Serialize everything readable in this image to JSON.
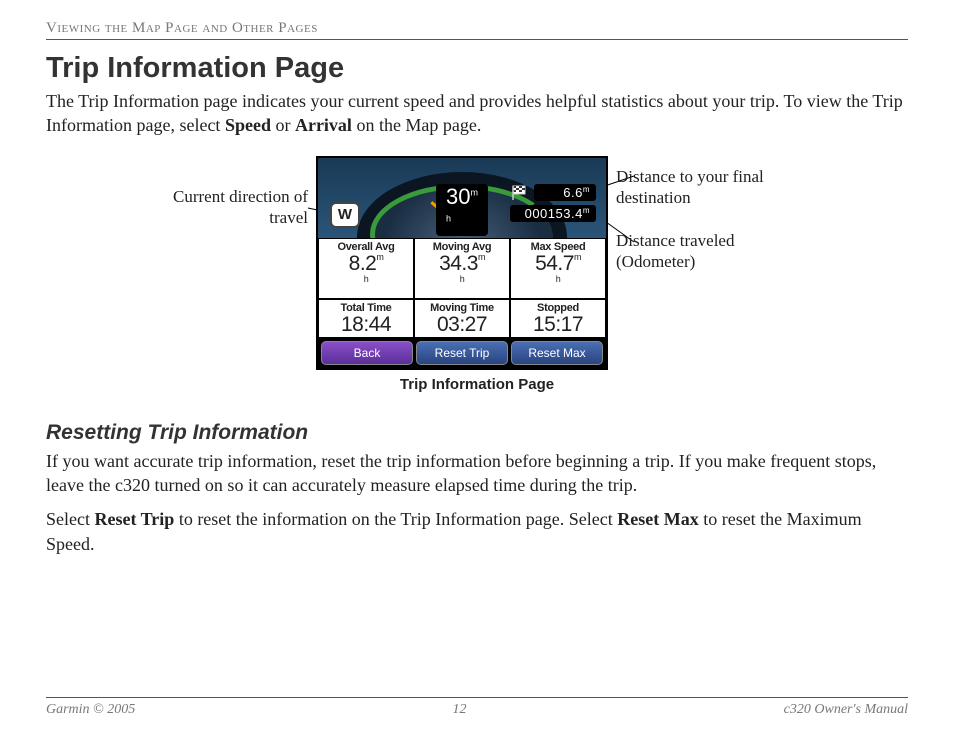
{
  "section_header": "Viewing the Map Page and Other Pages",
  "title": "Trip Information Page",
  "intro_parts": {
    "p1": "The Trip Information page indicates your current speed and provides helpful statistics about your trip. To view the Trip Information page, select ",
    "b1": "Speed",
    "p2": " or ",
    "b2": "Arrival",
    "p3": " on the Map page."
  },
  "annotations": {
    "left1": "Current direction of travel",
    "right1": "Distance to your final destination",
    "right2": "Distance traveled (Odometer)"
  },
  "device": {
    "direction": "W",
    "dist_to_dest": "6.6",
    "odometer": "000153.4",
    "speed": "30",
    "row1": {
      "c1_lbl": "Overall Avg",
      "c1_val": "8.2",
      "c2_lbl": "Moving Avg",
      "c2_val": "34.3",
      "c3_lbl": "Max Speed",
      "c3_val": "54.7"
    },
    "row2": {
      "c1_lbl": "Total Time",
      "c1_val": "18:44",
      "c2_lbl": "Moving Time",
      "c2_val": "03:27",
      "c3_lbl": "Stopped",
      "c3_val": "15:17"
    },
    "buttons": {
      "back": "Back",
      "reset_trip": "Reset Trip",
      "reset_max": "Reset Max"
    }
  },
  "caption": "Trip Information Page",
  "sub_heading": "Resetting Trip Information",
  "para2": "If you want accurate trip information, reset the trip information before beginning a trip. If you make frequent stops, leave the c320 turned on so it can accurately measure elapsed time during the trip.",
  "para3_parts": {
    "p1": "Select ",
    "b1": "Reset Trip",
    "p2": " to reset the information on the Trip Information page. Select ",
    "b2": "Reset Max",
    "p3": " to reset the Maximum Speed."
  },
  "footer": {
    "left": "Garmin © 2005",
    "center": "12",
    "right": "c320 Owner's Manual"
  },
  "unit_mph": "m h"
}
